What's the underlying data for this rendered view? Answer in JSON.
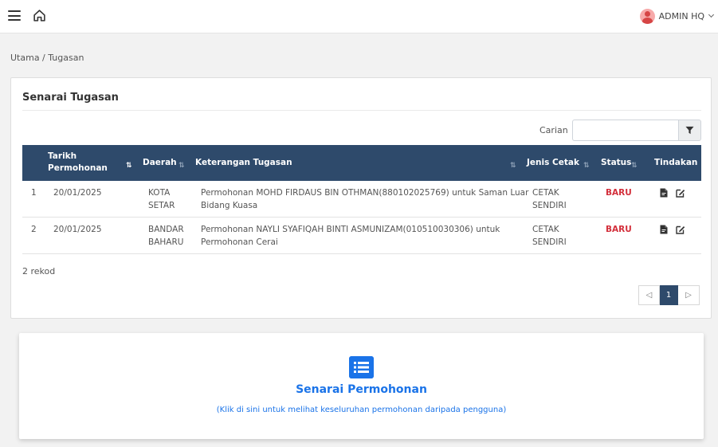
{
  "header": {
    "user_name": "ADMIN HQ",
    "icons": [
      "menu-icon",
      "home-icon",
      "avatar-icon",
      "chevron-down-icon"
    ]
  },
  "breadcrumb": "Utama / Tugasan",
  "card": {
    "title": "Senarai Tugasan",
    "search_label": "Carian",
    "search_value": "",
    "columns": [
      "",
      "Tarikh\nPermohonan",
      "Daerah",
      "Keterangan Tugasan",
      "Jenis Cetak",
      "Status",
      "Tindakan"
    ],
    "rows": [
      {
        "no": "1",
        "date": "20/01/2025",
        "district": "KOTA\nSETAR",
        "description": "Permohonan MOHD FIRDAUS BIN OTHMAN(880102025769) untuk Saman Luar\nBidang Kuasa",
        "print_type": "CETAK\nSENDIRI",
        "status": "BARU"
      },
      {
        "no": "2",
        "date": "20/01/2025",
        "district": "BANDAR\nBAHARU",
        "description": "Permohonan NAYLI SYAFIQAH BINTI ASMUNIZAM(010510030306) untuk\nPermohonan Cerai",
        "print_type": "CETAK\nSENDIRI",
        "status": "BARU"
      }
    ],
    "record_count": "2 rekod",
    "pagination": {
      "prev": "◁",
      "current": "1",
      "next": "▷"
    }
  },
  "applications": {
    "title": "Senarai Permohonan",
    "subtitle": "(Klik di sini untuk melihat keseluruhan permohonan daripada pengguna)"
  },
  "colors": {
    "table_header": "#2e4a6b",
    "status_new": "#d32f3b",
    "link_blue": "#1a73e8"
  }
}
